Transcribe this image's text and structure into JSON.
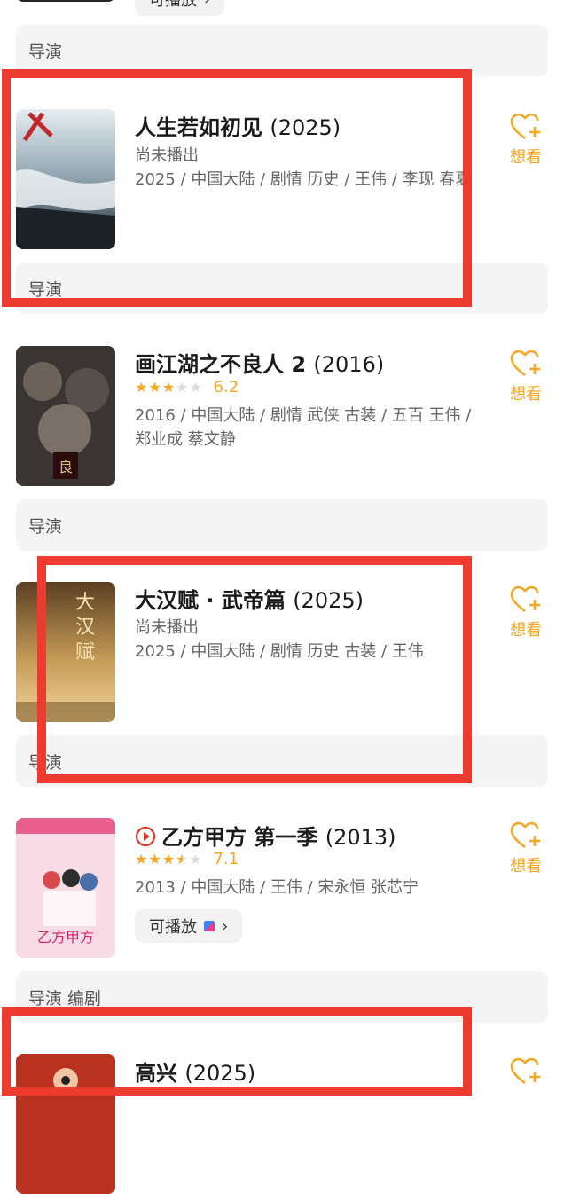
{
  "top_chip": {
    "label": "可播放"
  },
  "items": [
    {
      "role": "导演",
      "title": "人生若如初见",
      "year": "(2025)",
      "status": "尚未播出",
      "meta": "2025 / 中国大陆 / 剧情 历史 / 王伟 / 李现 春夏",
      "want_label": "想看"
    },
    {
      "role": "导演",
      "title": "画江湖之不良人 2",
      "year": "(2016)",
      "rating": "6.2",
      "stars": 3,
      "meta": "2016 / 中国大陆 / 剧情 武侠 古装 / 五百 王伟 / 郑业成 蔡文静",
      "want_label": "想看"
    },
    {
      "role": "导演",
      "title": "大汉赋 · 武帝篇",
      "year": "(2025)",
      "status": "尚未播出",
      "meta": "2025 / 中国大陆 / 剧情 历史 古装 / 王伟",
      "want_label": "想看"
    },
    {
      "role": "导演",
      "title": "乙方甲方 第一季",
      "year": "(2013)",
      "rating": "7.1",
      "stars": 3.5,
      "meta": "2013 / 中国大陆 / 王伟 / 宋永恒 张芯宁",
      "play_label": "可播放",
      "want_label": "想看"
    },
    {
      "role": "导演 编剧",
      "title": "高兴",
      "year": "(2025)"
    }
  ],
  "colors": {
    "accent": "#f5a623",
    "highlight": "#ee3b30",
    "role_bg": "#f4f4f4"
  }
}
